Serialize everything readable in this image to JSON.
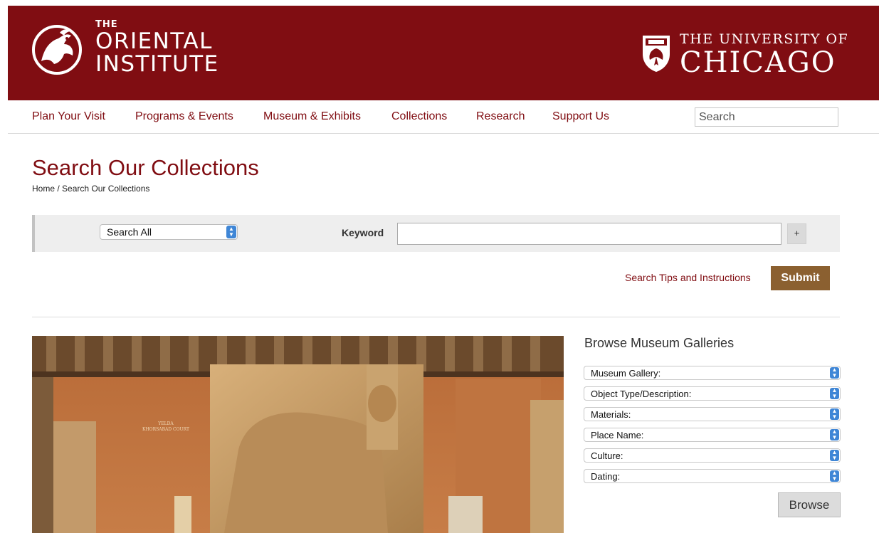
{
  "header": {
    "oi_logo_lines": [
      "THE",
      "ORIENTAL",
      "INSTITUTE"
    ],
    "uc_logo_lines": [
      "THE UNIVERSITY OF",
      "CHICAGO"
    ]
  },
  "nav": {
    "items": [
      {
        "label": "Plan Your Visit"
      },
      {
        "label": "Programs & Events"
      },
      {
        "label": "Museum & Exhibits"
      },
      {
        "label": "Collections"
      },
      {
        "label": "Research"
      },
      {
        "label": "Support Us"
      }
    ],
    "search_placeholder": "Search"
  },
  "page": {
    "title": "Search Our Collections",
    "breadcrumb": "Home / Search Our Collections"
  },
  "search": {
    "scope_selected": "Search All",
    "keyword_label": "Keyword",
    "keyword_value": "",
    "add_label": "+",
    "tips_link": "Search Tips and Instructions",
    "submit_label": "Submit"
  },
  "photo": {
    "wall_label_lines": [
      "YELDA",
      "KHORSABAD COURT"
    ]
  },
  "browse": {
    "title": "Browse Museum Galleries",
    "filters": [
      {
        "label": "Museum Gallery:"
      },
      {
        "label": "Object Type/Description:"
      },
      {
        "label": "Materials:"
      },
      {
        "label": "Place Name:"
      },
      {
        "label": "Culture:"
      },
      {
        "label": "Dating:"
      }
    ],
    "button_label": "Browse"
  },
  "colors": {
    "brand_maroon": "#800d12",
    "submit_brown": "#8b6030",
    "select_arrow_blue": "#3f86d6"
  }
}
